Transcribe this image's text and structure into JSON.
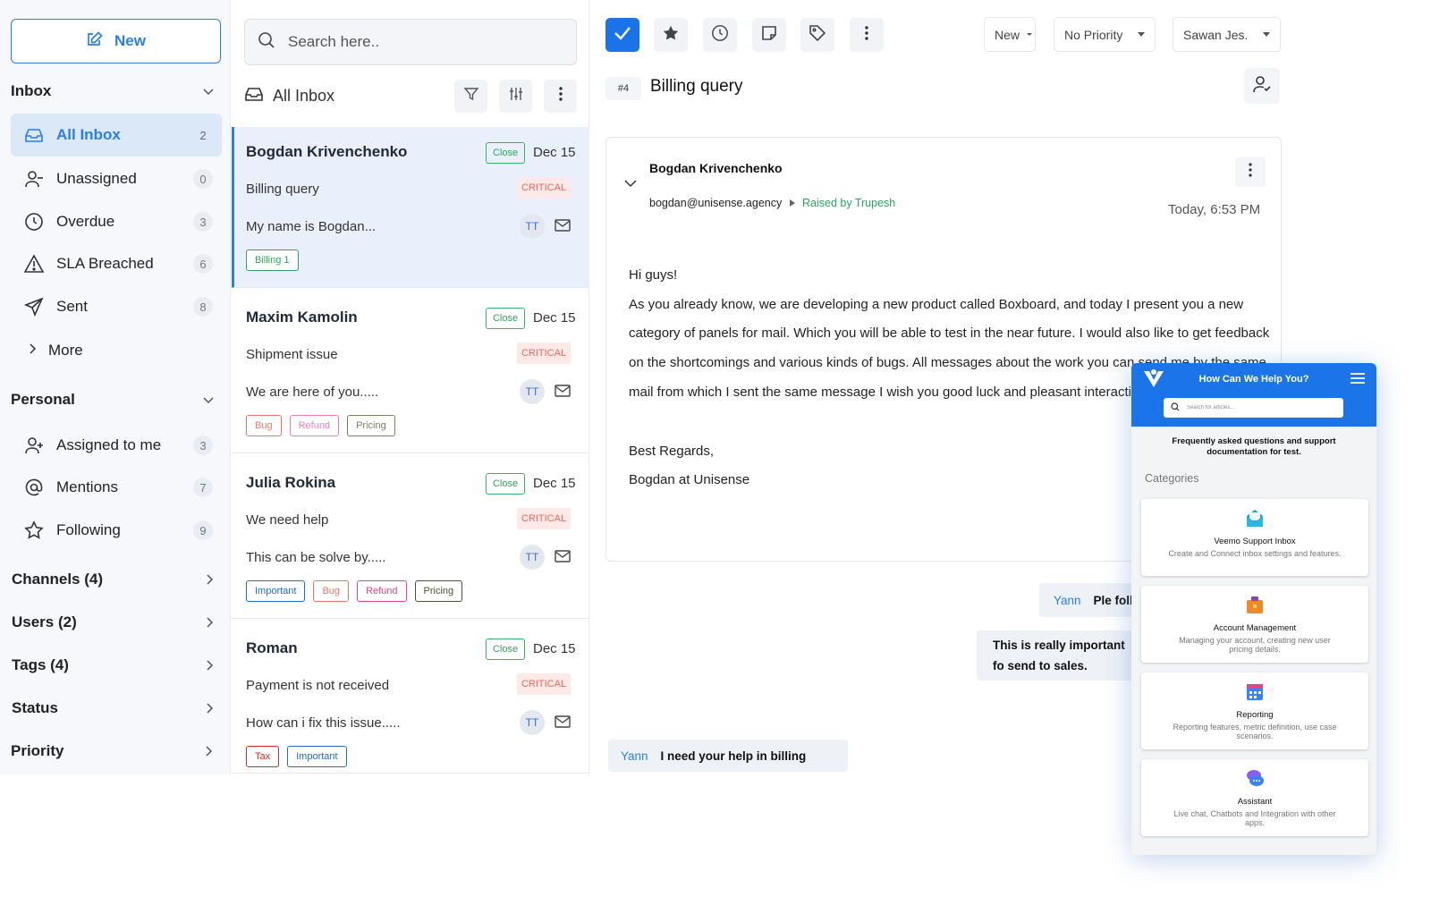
{
  "sidebar": {
    "new_label": "New",
    "inbox_heading": "Inbox",
    "inbox_items": [
      {
        "label": "All Inbox",
        "count": "2"
      },
      {
        "label": "Unassigned",
        "count": "0"
      },
      {
        "label": "Overdue",
        "count": "3"
      },
      {
        "label": "SLA Breached",
        "count": "6"
      },
      {
        "label": "Sent",
        "count": "8"
      }
    ],
    "more_label": "More",
    "personal_heading": "Personal",
    "personal_items": [
      {
        "label": "Assigned to me",
        "count": "3"
      },
      {
        "label": "Mentions",
        "count": "7"
      },
      {
        "label": "Following",
        "count": "9"
      }
    ],
    "groups": [
      "Channels (4)",
      "Users (2)",
      "Tags (4)",
      "Status",
      "Priority"
    ]
  },
  "list": {
    "search_placeholder": "Search here..",
    "title": "All Inbox",
    "tickets": [
      {
        "name": "Bogdan Krivenchenko",
        "status": "Close",
        "date": "Dec 15",
        "subject": "Billing query",
        "priority": "CRITICAL",
        "preview": "My name is Bogdan...",
        "avatar": "TT",
        "tags": [
          {
            "label": "Billing 1",
            "color": "#2fa35f"
          }
        ]
      },
      {
        "name": "Maxim Kamolin",
        "status": "Close",
        "date": "Dec 15",
        "subject": "Shipment issue",
        "priority": "CRITICAL",
        "preview": "We are here of you.....",
        "avatar": "TT",
        "tags": [
          {
            "label": "Bug",
            "color": "#e8776b"
          },
          {
            "label": "Refund",
            "color": "#ee80b8"
          },
          {
            "label": "Pricing",
            "color": "#7b7f66"
          }
        ]
      },
      {
        "name": "Julia Rokina",
        "status": "Close",
        "date": "Dec 15",
        "subject": "We need help",
        "priority": "CRITICAL",
        "preview": "This can be solve by.....",
        "avatar": "TT",
        "tags": [
          {
            "label": "Important",
            "color": "#1a6fd8"
          },
          {
            "label": "Bug",
            "color": "#e8776b"
          },
          {
            "label": "Refund",
            "color": "#e0468e"
          },
          {
            "label": "Pricing",
            "color": "#4c5133"
          }
        ]
      },
      {
        "name": "Roman",
        "status": "Close",
        "date": "Dec 15",
        "subject": "Payment is not received",
        "priority": "CRITICAL",
        "preview": "How can i fix this issue.....",
        "avatar": "TT",
        "tags": [
          {
            "label": "Tax",
            "color": "#e0271f"
          },
          {
            "label": "Important",
            "color": "#1a6fd8"
          }
        ]
      }
    ]
  },
  "detail": {
    "status_dd": "New",
    "priority_dd": "No Priority",
    "agent_dd": "Sawan Jes.",
    "ticket_no": "#4",
    "ticket_title": "Billing query",
    "message": {
      "from": "Bogdan Krivenchenko",
      "email": "bogdan@unisense.agency",
      "raised": "Raised by Trupesh",
      "time": "Today, 6:53 PM",
      "greeting": "Hi guys!",
      "body": "As you already know, we are developing a new product called Boxboard, and today I present you a new category of panels for mail. Which you will be able to test in the near future. I would also like to get feedback on the shortcomings and various kinds of bugs. All messages about the work you can send me by the same mail from which I sent the same message I wish you good luck and pleasant interaction with the panel.",
      "signoff": "Best Regards,",
      "signature": "Bogdan at Unisense"
    },
    "chats": [
      {
        "who": "Yann",
        "text": "Ple follo"
      },
      {
        "who": "",
        "text": "This is really important fo send to sales."
      },
      {
        "who": "Yann",
        "text": "I need your help in billing"
      }
    ]
  },
  "widget": {
    "title": "How Can We Help You?",
    "search_placeholder": "Search for articles...",
    "intro": "Frequently asked questions and support documentation for test.",
    "categories_label": "Categories",
    "cards": [
      {
        "title": "Veemo Support Inbox",
        "desc": "Create and Connect inbox settings and features.",
        "icon": "envelope-open-icon"
      },
      {
        "title": "Account Management",
        "desc": "Managing your account, creating new user pricing details.",
        "icon": "briefcase-icon"
      },
      {
        "title": "Reporting",
        "desc": "Reporting features, metric definition, use case scenarios.",
        "icon": "calendar-icon"
      },
      {
        "title": "Assistant",
        "desc": "Live chat, Chatbots and Integration with other apps.",
        "icon": "chat-bubbles-icon"
      }
    ]
  },
  "colors": {
    "accent": "#2b7de9",
    "primary_button": "#1a73e8",
    "status_close": "#2fa35f",
    "critical": "#e86a5e"
  }
}
